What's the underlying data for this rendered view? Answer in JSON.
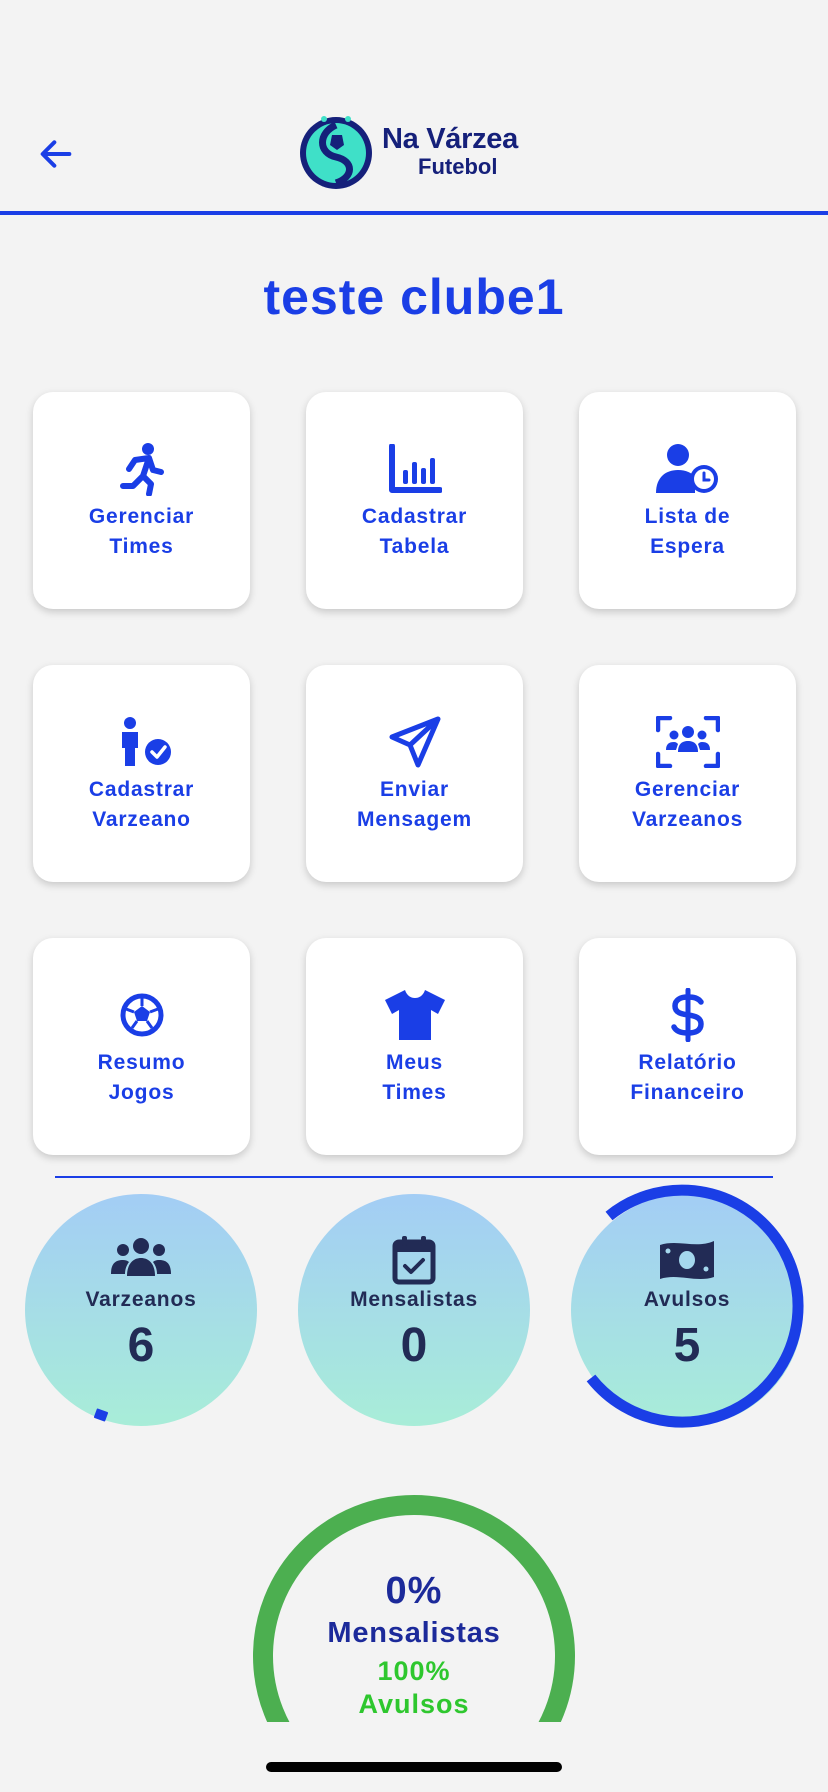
{
  "header": {
    "back_icon": "arrow-left-icon",
    "logo_title": "Na Várzea",
    "logo_subtitle": "Futebol"
  },
  "club_name": "teste clube1",
  "menu": [
    {
      "icon": "running-person-icon",
      "line1": "Gerenciar",
      "line2": "Times"
    },
    {
      "icon": "bar-chart-icon",
      "line1": "Cadastrar",
      "line2": "Tabela"
    },
    {
      "icon": "user-clock-icon",
      "line1": "Lista de",
      "line2": "Espera"
    },
    {
      "icon": "person-check-icon",
      "line1": "Cadastrar",
      "line2": "Varzeano"
    },
    {
      "icon": "paper-plane-icon",
      "line1": "Enviar",
      "line2": "Mensagem"
    },
    {
      "icon": "group-frame-icon",
      "line1": "Gerenciar",
      "line2": "Varzeanos"
    },
    {
      "icon": "soccer-ball-icon",
      "line1": "Resumo",
      "line2": "Jogos"
    },
    {
      "icon": "tshirt-icon",
      "line1": "Meus",
      "line2": "Times"
    },
    {
      "icon": "dollar-icon",
      "line1": "Relatório",
      "line2": "Financeiro"
    }
  ],
  "stats": [
    {
      "icon": "people-icon",
      "label": "Varzeanos",
      "value": "6"
    },
    {
      "icon": "calendar-check-icon",
      "label": "Mensalistas",
      "value": "0"
    },
    {
      "icon": "money-icon",
      "label": "Avulsos",
      "value": "5"
    }
  ],
  "summary": {
    "mensalistas_pct": "0%",
    "mensalistas_label": "Mensalistas",
    "avulsos_pct": "100%",
    "avulsos_label": "Avulsos"
  },
  "colors": {
    "primary": "#1a3ee6",
    "dark_navy": "#222b55",
    "green": "#4caf50",
    "bright_green": "#2ec72e"
  }
}
